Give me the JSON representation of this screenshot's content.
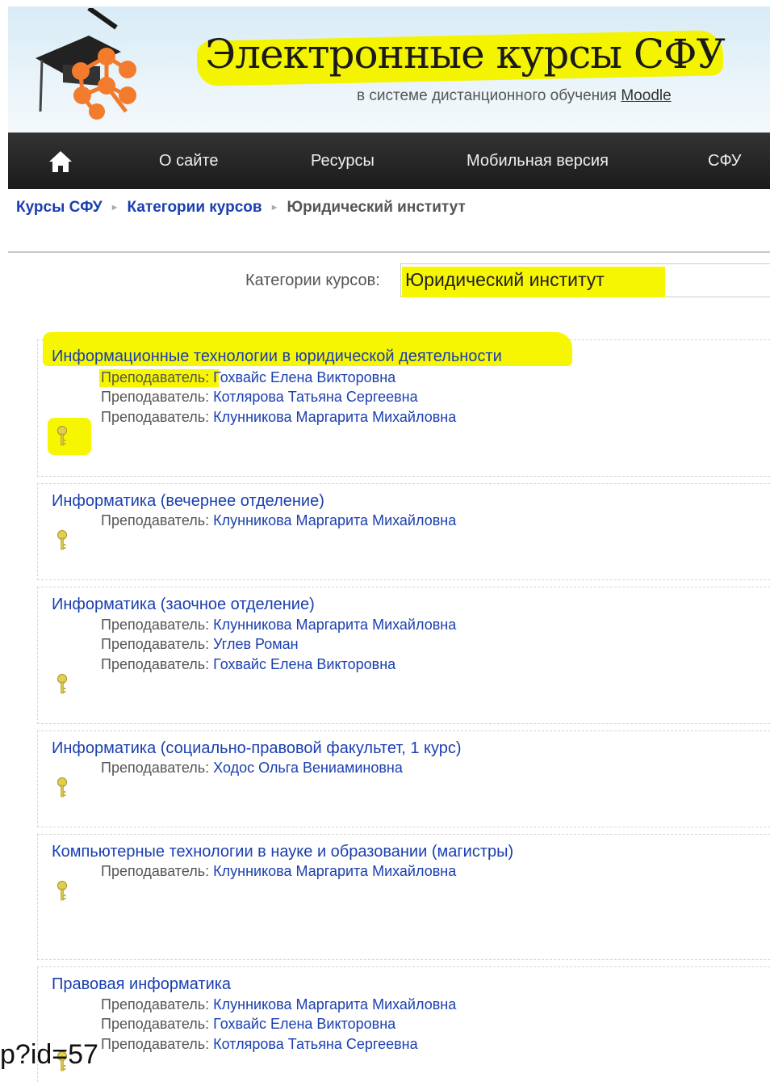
{
  "header": {
    "title": "Электронные курсы СФУ",
    "subtitle_prefix": "в системе дистанционного обучения",
    "subtitle_link": "Moodle",
    "highlight_color": "#f4f400"
  },
  "nav": {
    "home_icon": "home-icon",
    "items": [
      "О сайте",
      "Ресурсы",
      "Мобильная версия",
      "СФУ"
    ]
  },
  "breadcrumb": {
    "items": [
      "Курсы СФУ",
      "Категории курсов",
      "Юридический институт"
    ]
  },
  "category": {
    "label": "Категории курсов:",
    "selected": "Юридический институт"
  },
  "courses": [
    {
      "name": "Информационные технологии в юридической деятельности",
      "teachers": [
        {
          "role": "Преподаватель:",
          "name": "Гохвайс Елена Викторовна"
        },
        {
          "role": "Преподаватель:",
          "name": "Котлярова Татьяна Сергеевна"
        },
        {
          "role": "Преподаватель:",
          "name": "Клунникова Маргарита Михайловна"
        }
      ]
    },
    {
      "name": "Информатика (вечернее отделение)",
      "teachers": [
        {
          "role": "Преподаватель:",
          "name": "Клунникова Маргарита Михайловна"
        }
      ]
    },
    {
      "name": "Информатика (заочное отделение)",
      "teachers": [
        {
          "role": "Преподаватель:",
          "name": "Клунникова Маргарита Михайловна"
        },
        {
          "role": "Преподаватель:",
          "name": "Углев Роман"
        },
        {
          "role": "Преподаватель:",
          "name": "Гохвайс Елена Викторовна"
        }
      ]
    },
    {
      "name": "Информатика (социально-правовой факультет, 1 курс)",
      "teachers": [
        {
          "role": "Преподаватель:",
          "name": "Ходос Ольга Вениаминовна"
        }
      ]
    },
    {
      "name": "Компьютерные технологии в науке и образовании (магистры)",
      "teachers": [
        {
          "role": "Преподаватель:",
          "name": "Клунникова Маргарита Михайловна"
        }
      ]
    },
    {
      "name": "Правовая информатика",
      "teachers": [
        {
          "role": "Преподаватель:",
          "name": "Клунникова Маргарита Михайловна"
        },
        {
          "role": "Преподаватель:",
          "name": "Гохвайс Елена Викторовна"
        },
        {
          "role": "Преподаватель:",
          "name": "Котлярова Татьяна Сергеевна"
        }
      ]
    }
  ],
  "url_fragment": "p?id=57",
  "colors": {
    "link": "#1a3fb0",
    "navbar": "#222222",
    "highlight": "#f6f600",
    "key_icon": "#d8c44a"
  }
}
